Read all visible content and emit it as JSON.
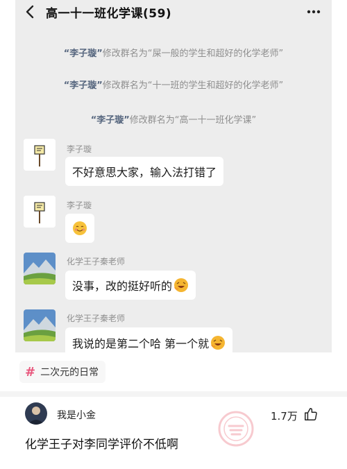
{
  "header": {
    "title": "高一十一班化学课(59)"
  },
  "system_messages": [
    {
      "who": "“李子璇”",
      "text": "修改群名为“屎一般的学生和超好的化学老师”"
    },
    {
      "who": "“李子璇”",
      "text": "修改群名为“十一班的学生和超好的化学老师”"
    },
    {
      "who": "“李子璇”",
      "text": "修改群名为“高一十一班化学课”"
    }
  ],
  "messages": [
    {
      "sender": "李子璇",
      "text": "不好意思大家，输入法打错了",
      "avatar": "sign-avatar"
    },
    {
      "sender": "李子璇",
      "text": "",
      "emoji": "smile-emoji",
      "avatar": "sign-avatar"
    },
    {
      "sender": "化学王子秦老师",
      "text": "没事，改的挺好听的",
      "emoji": "laugh-emoji",
      "avatar": "landscape-avatar"
    },
    {
      "sender": "化学王子秦老师",
      "text": "我说的是第二个哈  第一个就",
      "emoji": "laugh-emoji",
      "avatar": "landscape-avatar"
    }
  ],
  "topic_tag": {
    "hash": "#",
    "label": "二次元的日常"
  },
  "comment": {
    "username": "我是小金",
    "likes": "1.7万",
    "text": "化学王子对李同学评价不低啊"
  },
  "colors": {
    "chat_bg": "#ededed",
    "sys_name": "#57677f",
    "tag_hash": "#e8567c"
  }
}
